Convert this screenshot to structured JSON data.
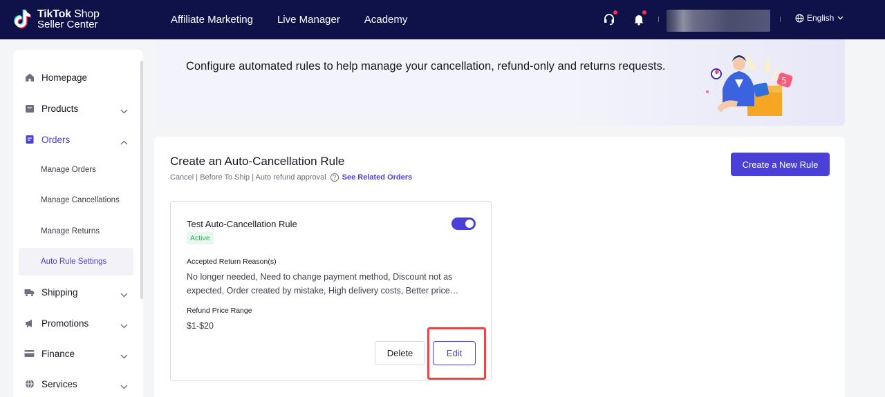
{
  "brand": {
    "line1_bold": "TikTok",
    "line1_rest": " Shop",
    "line2": "Seller Center"
  },
  "nav": {
    "links": [
      "Affiliate Marketing",
      "Live Manager",
      "Academy"
    ]
  },
  "header": {
    "language": "English",
    "notification_dot_color": "#fe2c55"
  },
  "sidebar": {
    "items": [
      {
        "label": "Homepage",
        "icon": "home-icon"
      },
      {
        "label": "Products",
        "icon": "bag-icon"
      },
      {
        "label": "Orders",
        "icon": "document-icon"
      },
      {
        "label": "Shipping",
        "icon": "truck-icon"
      },
      {
        "label": "Promotions",
        "icon": "megaphone-icon"
      },
      {
        "label": "Finance",
        "icon": "card-icon"
      },
      {
        "label": "Services",
        "icon": "globe-icon"
      }
    ],
    "orders_sub": [
      "Manage Orders",
      "Manage Cancellations",
      "Manage Returns",
      "Auto Rule Settings"
    ]
  },
  "banner": {
    "text": "Configure automated rules to help manage your cancellation, refund-only and returns requests."
  },
  "main": {
    "title": "Create an Auto-Cancellation Rule",
    "subtitle": "Cancel | Before To Ship | Auto refund approval",
    "related_link": "See Related Orders",
    "create_button": "Create a New Rule",
    "accent_color": "#4a3fd6"
  },
  "rule": {
    "name": "Test Auto-Cancellation Rule",
    "status": "Active",
    "enabled": true,
    "reasons_label": "Accepted Return Reason(s)",
    "reasons_value": "No longer needed, Need to change payment method, Discount not as expected, Order created by mistake, High delivery costs, Better price available",
    "price_label": "Refund Price Range",
    "price_value": "$1-$20",
    "delete_button": "Delete",
    "edit_button": "Edit"
  }
}
